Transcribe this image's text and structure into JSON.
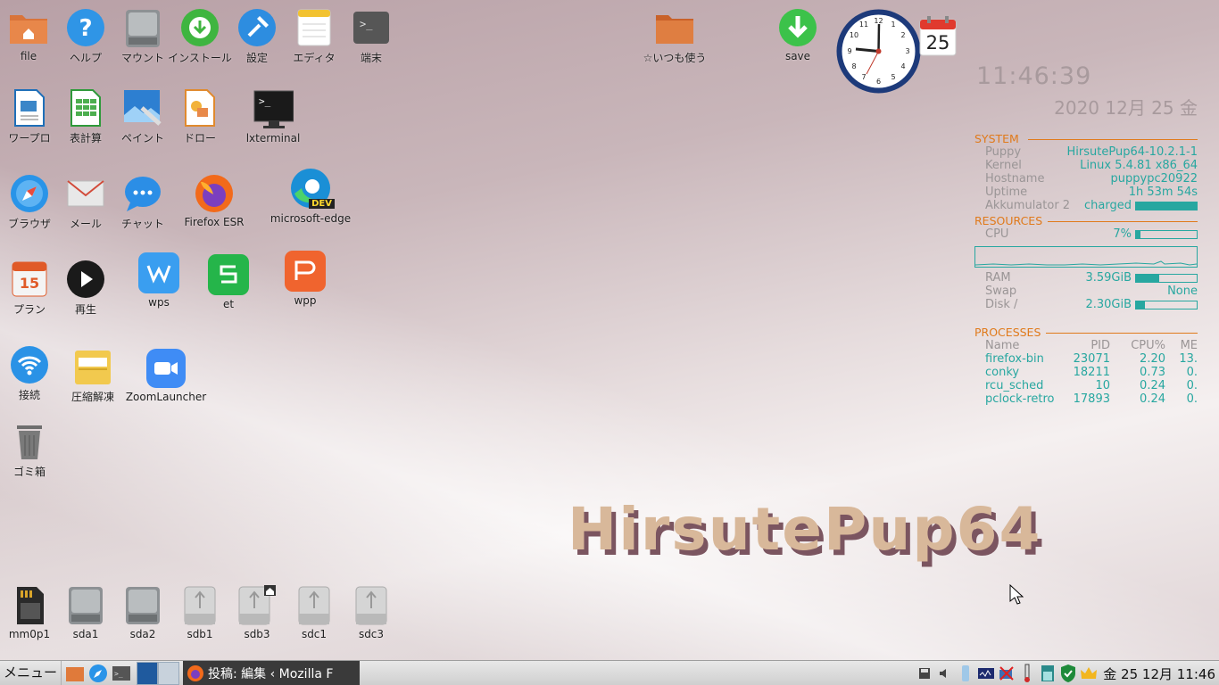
{
  "desktop": {
    "icons": {
      "file": "file",
      "help": "ヘルプ",
      "mount": "マウント",
      "install": "インストール",
      "settings": "設定",
      "editor": "エディタ",
      "terminal": "端末",
      "favorites": "☆いつも使う",
      "save": "save",
      "wordpro": "ワープロ",
      "spreadsheet": "表計算",
      "paint": "ペイント",
      "draw": "ドロー",
      "lxterminal": "lxterminal",
      "browser": "ブラウザ",
      "mail": "メール",
      "chat": "チャット",
      "firefox": "Firefox ESR",
      "edge": "microsoft-edge",
      "edge_badge": "DEV",
      "plan": "プラン",
      "plan_day": "15",
      "play": "再生",
      "wps": "wps",
      "et": "et",
      "wpp": "wpp",
      "connect": "接続",
      "archive": "圧縮解凍",
      "zoom": "ZoomLauncher",
      "trash": "ゴミ箱"
    },
    "drives": [
      "mm0p1",
      "sda1",
      "sda2",
      "sdb1",
      "sdb3",
      "sdc1",
      "sdc3"
    ],
    "wallpaper_text": "HirsutePup64",
    "calendar_day": "25"
  },
  "conky": {
    "time": "11:46:39",
    "date": "2020 12月 25 金",
    "system": {
      "title": "SYSTEM",
      "rows": [
        {
          "k": "Puppy",
          "v": "HirsutePup64-10.2.1-1"
        },
        {
          "k": "Kernel",
          "v": "Linux 5.4.81 x86_64"
        },
        {
          "k": "Hostname",
          "v": "puppypc20922"
        },
        {
          "k": "Uptime",
          "v": "1h 53m 54s"
        }
      ],
      "battery_label": "Akkumulator 2",
      "battery_state": "charged",
      "battery_fraction": 1.0
    },
    "resources": {
      "title": "RESOURCES",
      "cpu_label": "CPU",
      "cpu_value": "7%",
      "cpu_fraction": 0.07,
      "ram_label": "RAM",
      "ram_value": "3.59GiB",
      "ram_fraction": 0.38,
      "swap_label": "Swap",
      "swap_value": "None",
      "disk_label": "Disk /",
      "disk_value": "2.30GiB",
      "disk_fraction": 0.15
    },
    "processes": {
      "title": "PROCESSES",
      "headers": [
        "Name",
        "PID",
        "CPU%",
        "ME"
      ],
      "rows": [
        [
          "firefox-bin",
          "23071",
          "2.20",
          "13."
        ],
        [
          "conky",
          "18211",
          "0.73",
          "0."
        ],
        [
          "rcu_sched",
          "10",
          "0.24",
          "0."
        ],
        [
          "pclock-retro",
          "17893",
          "0.24",
          "0."
        ]
      ]
    }
  },
  "taskbar": {
    "menu": "メニュー",
    "task_title": "投稿: 編集 ‹ Mozilla F",
    "clock": "金 25 12月 11:46"
  },
  "colors": {
    "accent_teal": "#27a7a0",
    "accent_orange": "#e07a1b"
  }
}
